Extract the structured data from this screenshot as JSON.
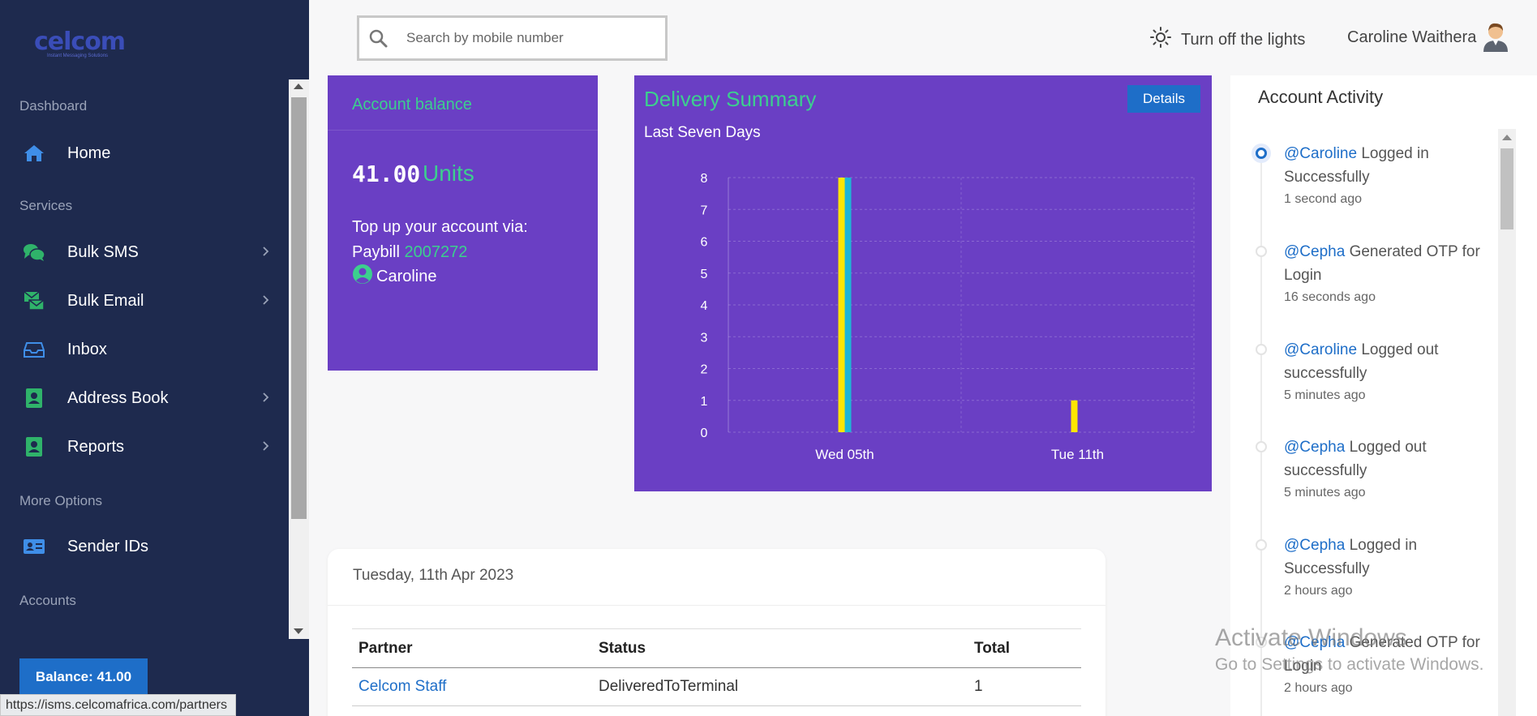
{
  "sidebar": {
    "logo_text": "celcom",
    "logo_sub": "Instant Messaging Solutions",
    "sections": {
      "dashboard": "Dashboard",
      "services": "Services",
      "more_options": "More Options",
      "accounts": "Accounts"
    },
    "items": [
      {
        "label": "Home",
        "icon": "home-icon"
      },
      {
        "label": "Bulk SMS",
        "icon": "chat-icon",
        "has_submenu": true
      },
      {
        "label": "Bulk Email",
        "icon": "email-icon",
        "has_submenu": true
      },
      {
        "label": "Inbox",
        "icon": "inbox-icon"
      },
      {
        "label": "Address Book",
        "icon": "contact-book-icon",
        "has_submenu": true
      },
      {
        "label": "Reports",
        "icon": "reports-icon",
        "has_submenu": true
      },
      {
        "label": "Sender IDs",
        "icon": "id-card-icon"
      }
    ],
    "balance_button": "Balance: 41.00"
  },
  "status_bar": {
    "url": "https://isms.celcomafrica.com/partners"
  },
  "header": {
    "search_placeholder": "Search by mobile number",
    "lights_label": "Turn off the lights",
    "user_name": "Caroline Waithera"
  },
  "balance_card": {
    "title": "Account balance",
    "amount": "41.00",
    "units": "Units",
    "topup_line": "Top up your account via:",
    "paybill_label": "Paybill",
    "paybill_number": "2007272",
    "account_user": "Caroline"
  },
  "delivery": {
    "title": "Delivery Summary",
    "subtitle": "Last Seven Days",
    "details_label": "Details"
  },
  "chart_data": {
    "type": "bar",
    "categories": [
      "Wed 05th",
      "Tue 11th"
    ],
    "series": [
      {
        "values": [
          8,
          1
        ],
        "color": "#ffe600"
      },
      {
        "values": [
          8,
          0
        ],
        "color": "#1fb5d6"
      }
    ],
    "ylim": [
      0,
      8
    ],
    "yticks": [
      0,
      1,
      2,
      3,
      4,
      5,
      6,
      7,
      8
    ],
    "grid": true
  },
  "table": {
    "date": "Tuesday, 11th Apr 2023",
    "columns": [
      "Partner",
      "Status",
      "Total"
    ],
    "rows": [
      {
        "partner": "Celcom Staff",
        "status": "DeliveredToTerminal",
        "total": "1"
      }
    ]
  },
  "activity": {
    "title": "Account Activity",
    "items": [
      {
        "who": "@Caroline",
        "line1": "Logged in",
        "line2": "Successfully",
        "time": "1 second ago"
      },
      {
        "who": "@Cepha",
        "line1": "Generated OTP for",
        "line2": "Login",
        "time": "16 seconds ago"
      },
      {
        "who": "@Caroline",
        "line1": "Logged out",
        "line2": "successfully",
        "time": "5 minutes ago"
      },
      {
        "who": "@Cepha",
        "line1": "Logged out",
        "line2": "successfully",
        "time": "5 minutes ago"
      },
      {
        "who": "@Cepha",
        "line1": "Logged in",
        "line2": "Successfully",
        "time": "2 hours ago"
      },
      {
        "who": "@Cepha",
        "line1": "Generated OTP for",
        "line2": "Login",
        "time": "2 hours ago"
      }
    ]
  },
  "watermark": {
    "line1": "Activate Windows",
    "line2": "Go to Settings to activate Windows."
  }
}
